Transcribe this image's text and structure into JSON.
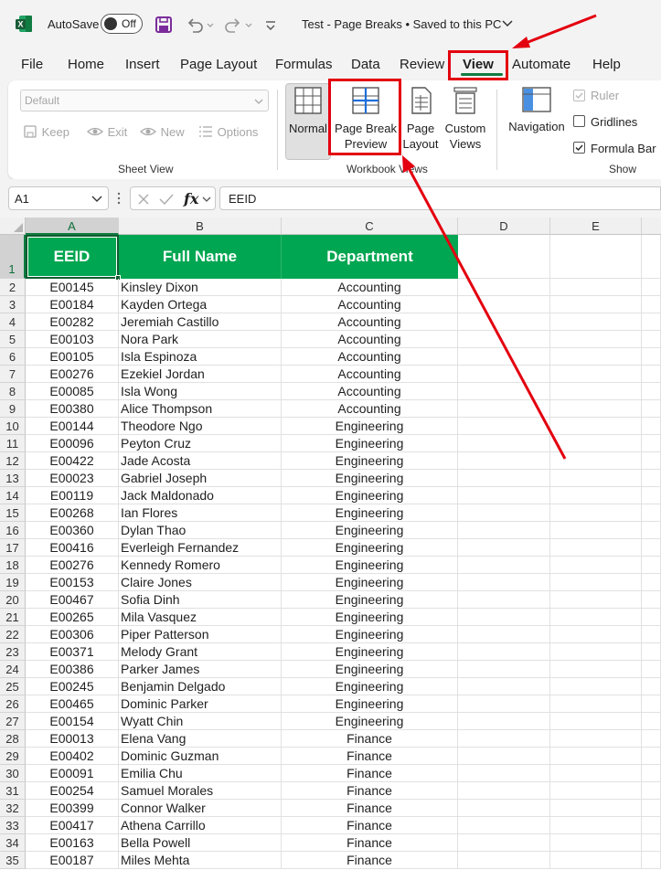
{
  "titlebar": {
    "autosave_label": "AutoSave",
    "autosave_state": "Off",
    "doc_title": "Test - Page Breaks • Saved to this PC",
    "accent": "#107c41"
  },
  "tabs": [
    "File",
    "Home",
    "Insert",
    "Page Layout",
    "Formulas",
    "Data",
    "Review",
    "View",
    "Automate",
    "Help"
  ],
  "active_tab": "View",
  "ribbon": {
    "sheet_view": {
      "dropdown_value": "Default",
      "buttons": [
        "Keep",
        "Exit",
        "New",
        "Options"
      ],
      "label": "Sheet View"
    },
    "workbook_views": {
      "normal": "Normal",
      "page_break_line1": "Page Break",
      "page_break_line2": "Preview",
      "page_layout_line1": "Page",
      "page_layout_line2": "Layout",
      "custom_line1": "Custom",
      "custom_line2": "Views",
      "label": "Workbook Views"
    },
    "show": {
      "navigation": "Navigation",
      "ruler": "Ruler",
      "gridlines": "Gridlines",
      "formula_bar": "Formula Bar",
      "label": "Show"
    }
  },
  "formula_bar": {
    "name_box": "A1",
    "fx": "fx",
    "value": "EEID"
  },
  "columns": [
    "A",
    "B",
    "C",
    "D",
    "E"
  ],
  "header_row": {
    "num": "1",
    "cells": [
      "EEID",
      "Full Name",
      "Department"
    ],
    "fill": "#00a651"
  },
  "rows": [
    {
      "n": "2",
      "id": "E00145",
      "name": "Kinsley Dixon",
      "dept": "Accounting"
    },
    {
      "n": "3",
      "id": "E00184",
      "name": "Kayden Ortega",
      "dept": "Accounting"
    },
    {
      "n": "4",
      "id": "E00282",
      "name": "Jeremiah Castillo",
      "dept": "Accounting"
    },
    {
      "n": "5",
      "id": "E00103",
      "name": "Nora Park",
      "dept": "Accounting"
    },
    {
      "n": "6",
      "id": "E00105",
      "name": "Isla Espinoza",
      "dept": "Accounting"
    },
    {
      "n": "7",
      "id": "E00276",
      "name": "Ezekiel Jordan",
      "dept": "Accounting"
    },
    {
      "n": "8",
      "id": "E00085",
      "name": "Isla Wong",
      "dept": "Accounting"
    },
    {
      "n": "9",
      "id": "E00380",
      "name": "Alice Thompson",
      "dept": "Accounting"
    },
    {
      "n": "10",
      "id": "E00144",
      "name": "Theodore Ngo",
      "dept": "Engineering"
    },
    {
      "n": "11",
      "id": "E00096",
      "name": "Peyton Cruz",
      "dept": "Engineering"
    },
    {
      "n": "12",
      "id": "E00422",
      "name": "Jade Acosta",
      "dept": "Engineering"
    },
    {
      "n": "13",
      "id": "E00023",
      "name": "Gabriel Joseph",
      "dept": "Engineering"
    },
    {
      "n": "14",
      "id": "E00119",
      "name": "Jack Maldonado",
      "dept": "Engineering"
    },
    {
      "n": "15",
      "id": "E00268",
      "name": "Ian Flores",
      "dept": "Engineering"
    },
    {
      "n": "16",
      "id": "E00360",
      "name": "Dylan Thao",
      "dept": "Engineering"
    },
    {
      "n": "17",
      "id": "E00416",
      "name": "Everleigh Fernandez",
      "dept": "Engineering"
    },
    {
      "n": "18",
      "id": "E00276",
      "name": "Kennedy Romero",
      "dept": "Engineering"
    },
    {
      "n": "19",
      "id": "E00153",
      "name": "Claire Jones",
      "dept": "Engineering"
    },
    {
      "n": "20",
      "id": "E00467",
      "name": "Sofia Dinh",
      "dept": "Engineering"
    },
    {
      "n": "21",
      "id": "E00265",
      "name": "Mila Vasquez",
      "dept": "Engineering"
    },
    {
      "n": "22",
      "id": "E00306",
      "name": "Piper Patterson",
      "dept": "Engineering"
    },
    {
      "n": "23",
      "id": "E00371",
      "name": "Melody Grant",
      "dept": "Engineering"
    },
    {
      "n": "24",
      "id": "E00386",
      "name": "Parker James",
      "dept": "Engineering"
    },
    {
      "n": "25",
      "id": "E00245",
      "name": "Benjamin Delgado",
      "dept": "Engineering"
    },
    {
      "n": "26",
      "id": "E00465",
      "name": "Dominic Parker",
      "dept": "Engineering"
    },
    {
      "n": "27",
      "id": "E00154",
      "name": "Wyatt Chin",
      "dept": "Engineering"
    },
    {
      "n": "28",
      "id": "E00013",
      "name": "Elena Vang",
      "dept": "Finance"
    },
    {
      "n": "29",
      "id": "E00402",
      "name": "Dominic Guzman",
      "dept": "Finance"
    },
    {
      "n": "30",
      "id": "E00091",
      "name": "Emilia Chu",
      "dept": "Finance"
    },
    {
      "n": "31",
      "id": "E00254",
      "name": "Samuel Morales",
      "dept": "Finance"
    },
    {
      "n": "32",
      "id": "E00399",
      "name": "Connor Walker",
      "dept": "Finance"
    },
    {
      "n": "33",
      "id": "E00417",
      "name": "Athena Carrillo",
      "dept": "Finance"
    },
    {
      "n": "34",
      "id": "E00163",
      "name": "Bella Powell",
      "dept": "Finance"
    },
    {
      "n": "35",
      "id": "E00187",
      "name": "Miles Mehta",
      "dept": "Finance"
    }
  ],
  "annotation_color": "#e3000f"
}
